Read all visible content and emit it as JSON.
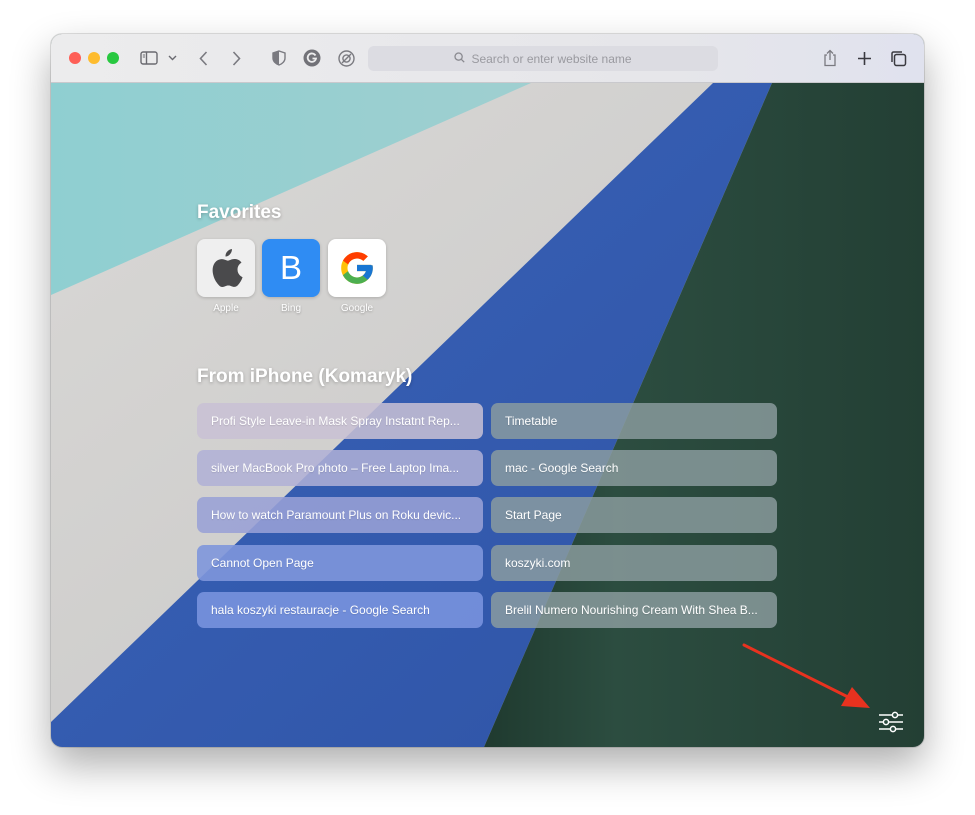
{
  "toolbar": {
    "search_placeholder": "Search or enter website name",
    "icons": [
      "sidebar-icon",
      "chevron-down-icon",
      "back-icon",
      "forward-icon",
      "privacy-shield-icon",
      "grammarly-icon",
      "extension-icon",
      "search-icon",
      "share-icon",
      "plus-icon",
      "tab-overview-icon"
    ]
  },
  "favorites": {
    "title": "Favorites",
    "items": [
      {
        "label": "Apple",
        "icon": "apple-logo-icon"
      },
      {
        "label": "Bing",
        "glyph": "B",
        "color": "#2f8cf3"
      },
      {
        "label": "Google",
        "icon": "google-logo-icon"
      }
    ]
  },
  "icloud_tabs": {
    "title": "From iPhone (Komaryk)",
    "left": [
      "Profi Style Leave-in Mask Spray Instatnt Rep...",
      "silver MacBook Pro photo – Free Laptop Ima...",
      "How to watch Paramount Plus on Roku devic...",
      "Cannot Open Page",
      "hala koszyki restauracje - Google Search"
    ],
    "right": [
      "Timetable",
      "mac - Google Search",
      "Start Page",
      "koszyki.com",
      "Brelil Numero Nourishing Cream With Shea B..."
    ]
  },
  "colors": {
    "traffic_red": "#fe5f57",
    "traffic_yellow": "#febc2e",
    "traffic_green": "#28c840",
    "annotation_arrow": "#e8321f"
  }
}
